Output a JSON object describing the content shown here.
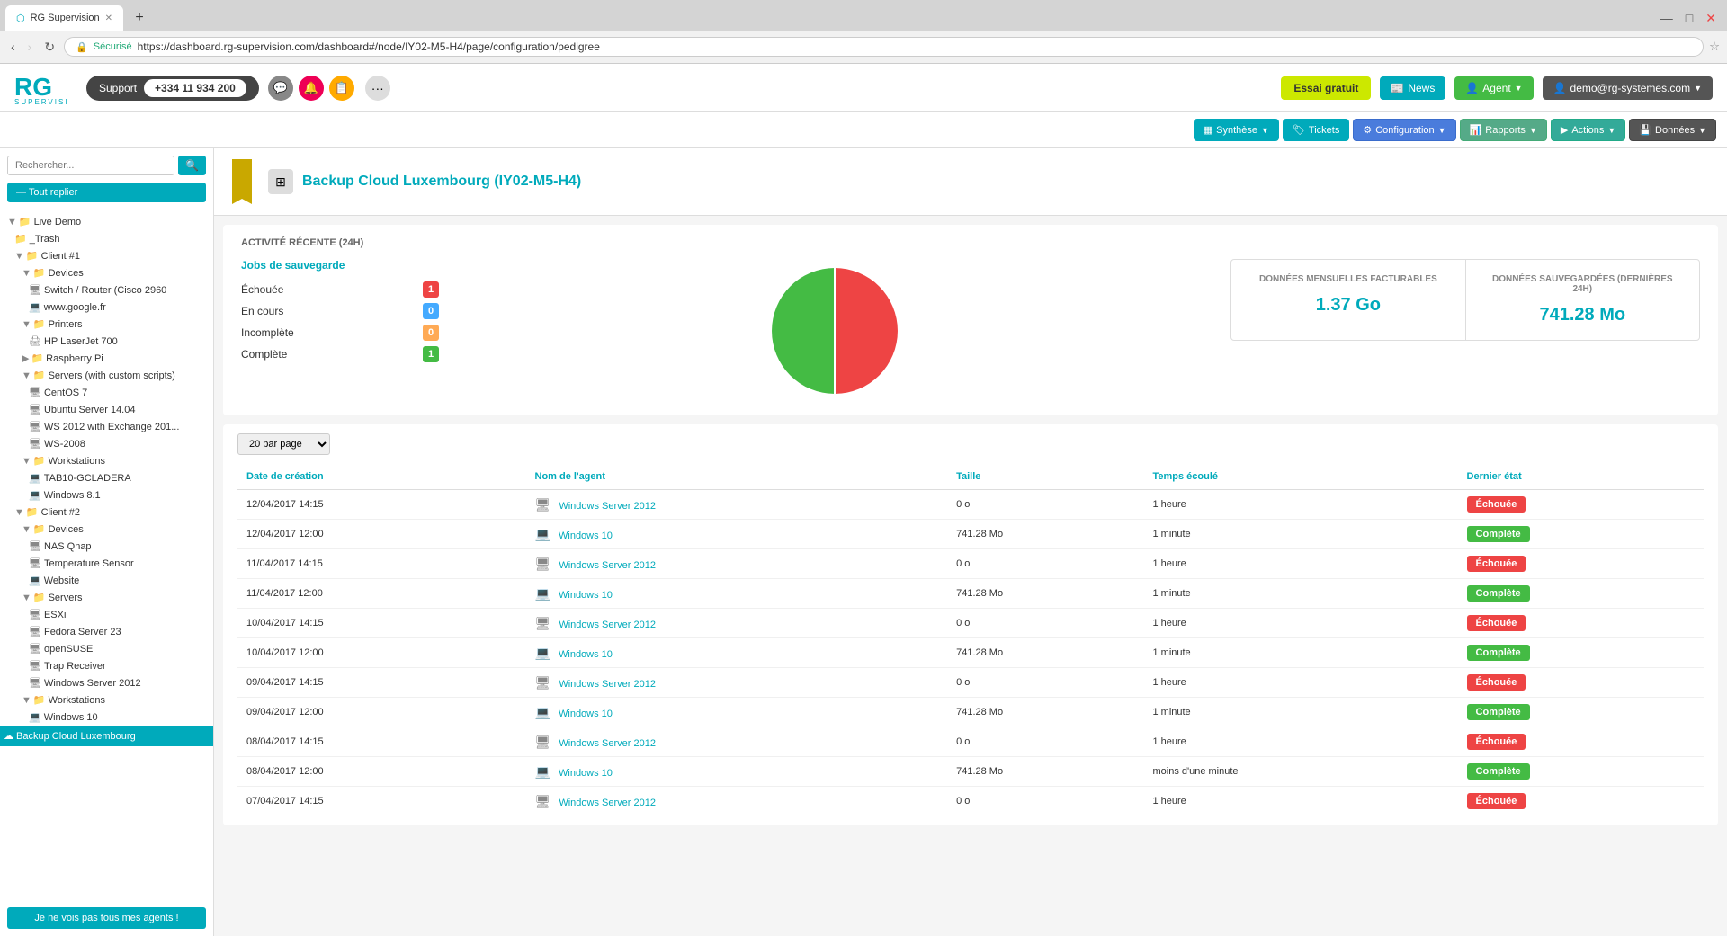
{
  "browser": {
    "tab_title": "RG Supervision",
    "url": "https://dashboard.rg-supervision.com/dashboard#/node/IY02-M5-H4/page/configuration/pedigree",
    "ssl_label": "Sécurisé"
  },
  "header": {
    "support_label": "Support",
    "phone": "+334 11 934 200",
    "more_label": "...",
    "essai_label": "Essai gratuit",
    "news_label": "News",
    "agent_label": "Agent",
    "user_label": "demo@rg-systemes.com"
  },
  "navbar": {
    "synthese_label": "Synthèse",
    "tickets_label": "Tickets",
    "configuration_label": "Configuration",
    "rapports_label": "Rapports",
    "actions_label": "Actions",
    "donnees_label": "Données"
  },
  "sidebar": {
    "search_placeholder": "Rechercher...",
    "search_btn_label": "🔍",
    "reply_btn_label": "— Tout replier",
    "tree": [
      {
        "id": "live-demo",
        "label": "Live Demo",
        "indent": 1,
        "type": "folder",
        "color": "green",
        "expanded": true
      },
      {
        "id": "trash",
        "label": "_Trash",
        "indent": 2,
        "type": "folder",
        "color": "normal"
      },
      {
        "id": "client1",
        "label": "Client #1",
        "indent": 2,
        "type": "folder",
        "color": "normal",
        "expanded": true
      },
      {
        "id": "devices1",
        "label": "Devices",
        "indent": 3,
        "type": "folder",
        "color": "normal",
        "expanded": true
      },
      {
        "id": "switch",
        "label": "Switch / Router (Cisco 2960",
        "indent": 4,
        "type": "server"
      },
      {
        "id": "google",
        "label": "www.google.fr",
        "indent": 4,
        "type": "desktop"
      },
      {
        "id": "printers",
        "label": "Printers",
        "indent": 3,
        "type": "folder",
        "color": "normal",
        "expanded": true
      },
      {
        "id": "hp",
        "label": "HP LaserJet 700",
        "indent": 4,
        "type": "print"
      },
      {
        "id": "raspberry",
        "label": "Raspberry Pi",
        "indent": 3,
        "type": "folder",
        "color": "red",
        "expanded": false
      },
      {
        "id": "servers1",
        "label": "Servers (with custom scripts)",
        "indent": 3,
        "type": "folder",
        "color": "normal",
        "expanded": true
      },
      {
        "id": "centos",
        "label": "CentOS 7",
        "indent": 4,
        "type": "server"
      },
      {
        "id": "ubuntu",
        "label": "Ubuntu Server 14.04",
        "indent": 4,
        "type": "server"
      },
      {
        "id": "ws2012",
        "label": "WS 2012 with Exchange 201...",
        "indent": 4,
        "type": "server"
      },
      {
        "id": "ws2008",
        "label": "WS-2008",
        "indent": 4,
        "type": "server"
      },
      {
        "id": "workstations1",
        "label": "Workstations",
        "indent": 3,
        "type": "folder",
        "color": "normal",
        "expanded": true
      },
      {
        "id": "tab10",
        "label": "TAB10-GCLADERA",
        "indent": 4,
        "type": "desktop"
      },
      {
        "id": "win81",
        "label": "Windows 8.1",
        "indent": 4,
        "type": "desktop"
      },
      {
        "id": "client2",
        "label": "Client #2",
        "indent": 2,
        "type": "folder",
        "color": "normal",
        "expanded": true
      },
      {
        "id": "devices2",
        "label": "Devices",
        "indent": 3,
        "type": "folder",
        "color": "normal",
        "expanded": true
      },
      {
        "id": "nas",
        "label": "NAS Qnap",
        "indent": 4,
        "type": "server"
      },
      {
        "id": "tempsensor",
        "label": "Temperature Sensor",
        "indent": 4,
        "type": "server"
      },
      {
        "id": "website",
        "label": "Website",
        "indent": 4,
        "type": "desktop"
      },
      {
        "id": "servers2",
        "label": "Servers",
        "indent": 3,
        "type": "folder",
        "color": "normal",
        "expanded": true
      },
      {
        "id": "esxi",
        "label": "ESXi",
        "indent": 4,
        "type": "server"
      },
      {
        "id": "fedora",
        "label": "Fedora Server 23",
        "indent": 4,
        "type": "server"
      },
      {
        "id": "opensuse",
        "label": "openSUSE",
        "indent": 4,
        "type": "server"
      },
      {
        "id": "trapreceiver",
        "label": "Trap Receiver",
        "indent": 4,
        "type": "server"
      },
      {
        "id": "winserver",
        "label": "Windows Server 2012",
        "indent": 4,
        "type": "server"
      },
      {
        "id": "workstations2",
        "label": "Workstations",
        "indent": 3,
        "type": "folder",
        "color": "normal",
        "expanded": true
      },
      {
        "id": "win10",
        "label": "Windows 10",
        "indent": 4,
        "type": "desktop"
      },
      {
        "id": "backupcloud",
        "label": "Backup Cloud Luxembourg",
        "indent": 3,
        "type": "backup",
        "selected": true
      }
    ],
    "agents_btn_label": "Je ne vois pas tous mes agents !"
  },
  "content": {
    "page_title": "Backup Cloud Luxembourg (IY02-M5-H4)",
    "activity_title": "ACTIVITÉ RÉCENTE (24H)",
    "jobs_title": "Jobs de sauvegarde",
    "jobs": [
      {
        "label": "Échouée",
        "count": "1",
        "badge_type": "red"
      },
      {
        "label": "En cours",
        "count": "0",
        "badge_type": "blue"
      },
      {
        "label": "Incomplète",
        "count": "0",
        "badge_type": "orange"
      },
      {
        "label": "Complète",
        "count": "1",
        "badge_type": "green"
      }
    ],
    "data_mensuelle_title": "DONNÉES MENSUELLES FACTURABLES",
    "data_mensuelle_value": "1.37 Go",
    "data_sauvegardees_title": "DONNÉES SAUVEGARDÉES (DERNIÈRES 24H)",
    "data_sauvegardees_value": "741.28 Mo",
    "per_page_label": "20 par page",
    "table_headers": [
      "Date de création",
      "Nom de l'agent",
      "Taille",
      "Temps écoulé",
      "Dernier état"
    ],
    "table_rows": [
      {
        "date": "12/04/2017 14:15",
        "agent": "Windows Server 2012",
        "agent_type": "server",
        "size": "0 o",
        "time": "1 heure",
        "status": "Échouée",
        "status_type": "failed"
      },
      {
        "date": "12/04/2017 12:00",
        "agent": "Windows 10",
        "agent_type": "desktop",
        "size": "741.28 Mo",
        "time": "1 minute",
        "status": "Complète",
        "status_type": "complete"
      },
      {
        "date": "11/04/2017 14:15",
        "agent": "Windows Server 2012",
        "agent_type": "server",
        "size": "0 o",
        "time": "1 heure",
        "status": "Échouée",
        "status_type": "failed"
      },
      {
        "date": "11/04/2017 12:00",
        "agent": "Windows 10",
        "agent_type": "desktop",
        "size": "741.28 Mo",
        "time": "1 minute",
        "status": "Complète",
        "status_type": "complete"
      },
      {
        "date": "10/04/2017 14:15",
        "agent": "Windows Server 2012",
        "agent_type": "server",
        "size": "0 o",
        "time": "1 heure",
        "status": "Échouée",
        "status_type": "failed"
      },
      {
        "date": "10/04/2017 12:00",
        "agent": "Windows 10",
        "agent_type": "desktop",
        "size": "741.28 Mo",
        "time": "1 minute",
        "status": "Complète",
        "status_type": "complete"
      },
      {
        "date": "09/04/2017 14:15",
        "agent": "Windows Server 2012",
        "agent_type": "server",
        "size": "0 o",
        "time": "1 heure",
        "status": "Échouée",
        "status_type": "failed"
      },
      {
        "date": "09/04/2017 12:00",
        "agent": "Windows 10",
        "agent_type": "desktop",
        "size": "741.28 Mo",
        "time": "1 minute",
        "status": "Complète",
        "status_type": "complete"
      },
      {
        "date": "08/04/2017 14:15",
        "agent": "Windows Server 2012",
        "agent_type": "server",
        "size": "0 o",
        "time": "1 heure",
        "status": "Échouée",
        "status_type": "failed"
      },
      {
        "date": "08/04/2017 12:00",
        "agent": "Windows 10",
        "agent_type": "desktop",
        "size": "741.28 Mo",
        "time": "moins d'une minute",
        "status": "Complète",
        "status_type": "complete"
      },
      {
        "date": "07/04/2017 14:15",
        "agent": "Windows Server 2012",
        "agent_type": "server",
        "size": "0 o",
        "time": "1 heure",
        "status": "Échouée",
        "status_type": "failed"
      }
    ]
  },
  "pie_chart": {
    "green_percent": 50,
    "red_percent": 50,
    "green_color": "#4b4",
    "red_color": "#e44"
  }
}
